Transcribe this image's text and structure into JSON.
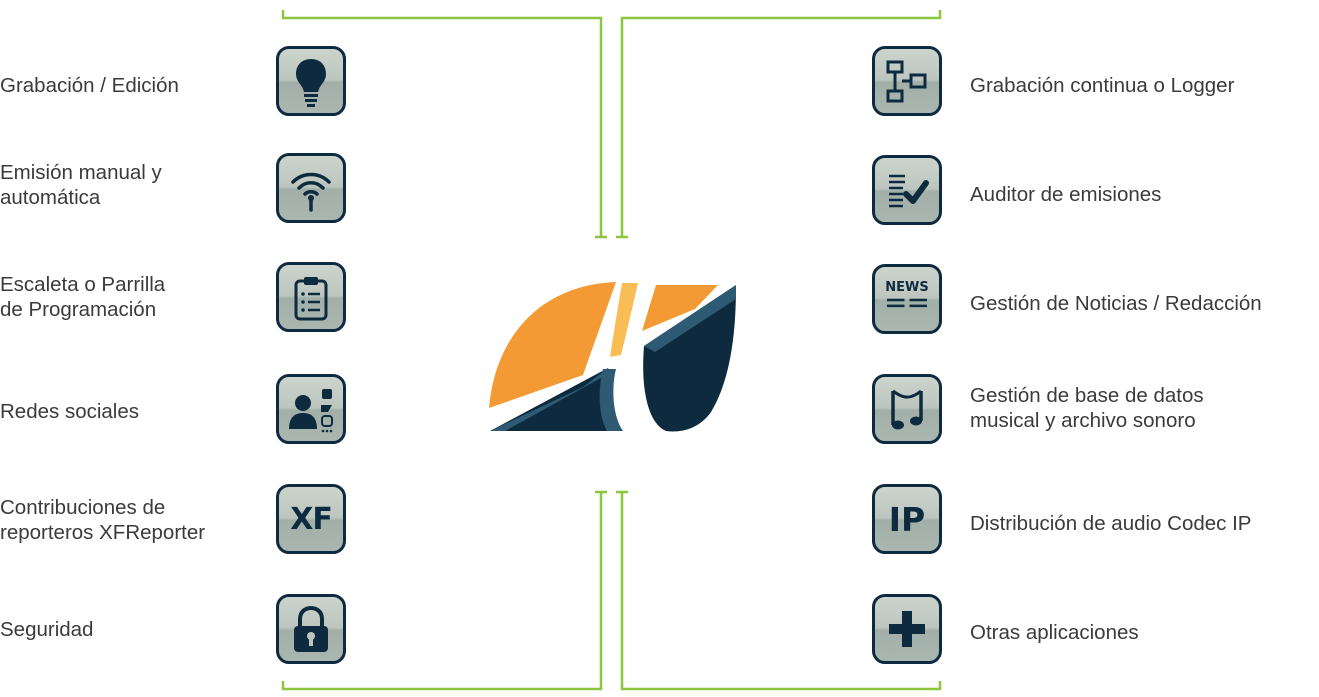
{
  "left_items": [
    {
      "label": "Grabación / Edición",
      "icon": "lightbulb-icon"
    },
    {
      "label": "Emisión manual y\nautomática",
      "icon": "wifi-antenna-icon"
    },
    {
      "label": "Escaleta o Parrilla\nde Programación",
      "icon": "clipboard-list-icon"
    },
    {
      "label": "Redes sociales",
      "icon": "social-media-icon"
    },
    {
      "label": "Contribuciones de\nreporteros XFReporter",
      "icon": "xf-icon"
    },
    {
      "label": "Seguridad",
      "icon": "padlock-icon"
    }
  ],
  "right_items": [
    {
      "label": "Grabación continua o Logger",
      "icon": "flowchart-icon"
    },
    {
      "label": "Auditor de emisiones",
      "icon": "checklist-icon"
    },
    {
      "label": "Gestión de Noticias / Redacción",
      "icon": "news-icon"
    },
    {
      "label": "Gestión de base de datos\nmusical y archivo sonoro",
      "icon": "music-note-icon"
    },
    {
      "label": "Distribución de audio Codec IP",
      "icon": "ip-icon"
    },
    {
      "label": "Otras aplicaciones",
      "icon": "plus-icon"
    }
  ],
  "icon_text": {
    "xf": "XF",
    "news": "NEWS",
    "ip": "IP"
  },
  "colors": {
    "bracket": "#8cc63f",
    "icon_border": "#0e2a3f",
    "logo_orange": "#f39a34",
    "logo_navy": "#0e2a3f",
    "logo_steel": "#2e5a73"
  }
}
